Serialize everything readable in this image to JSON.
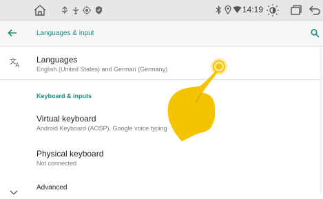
{
  "status_bar": {
    "time": "14:19",
    "left_icons": [
      "home-outline-icon",
      "usb-icon",
      "usb-connected-icon",
      "shield-icon"
    ],
    "right_icons": [
      "bluetooth-icon",
      "location-icon",
      "wifi-icon",
      "brightness-icon",
      "recent-apps-icon",
      "back-arrow-icon"
    ]
  },
  "app_bar": {
    "title": "Languages & input",
    "back_icon": "arrow-back-icon",
    "search_icon": "search-icon"
  },
  "items": {
    "languages": {
      "title": "Languages",
      "subtitle": "English (United States) and German (Germany)",
      "icon": "translate-icon"
    },
    "section_header": "Keyboard & inputs",
    "virtual_keyboard": {
      "title": "Virtual keyboard",
      "subtitle": "Android Keyboard (AOSP), Google voice typing"
    },
    "physical_keyboard": {
      "title": "Physical keyboard",
      "subtitle": "Not connected"
    },
    "advanced": {
      "title": "Advanced",
      "icon": "chevron-down-icon"
    }
  },
  "colors": {
    "accent": "#1a8b80",
    "hand": "#f5c400",
    "status_bar_bg": "#e7e7e7"
  }
}
